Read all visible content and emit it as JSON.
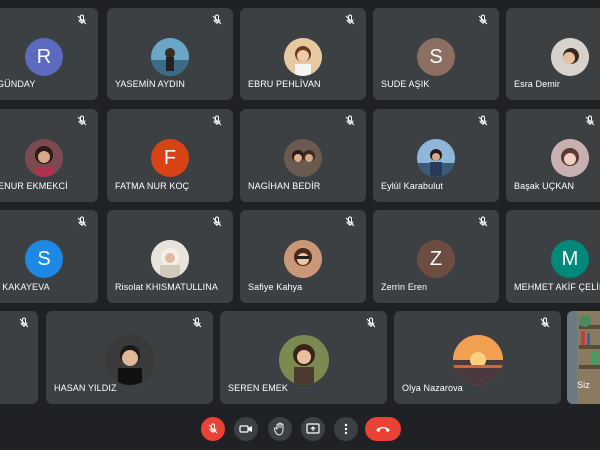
{
  "participants": [
    {
      "name": "T GÜNDAY",
      "initial": "R",
      "color": "#5c6bc0",
      "type": "letter"
    },
    {
      "name": "YASEMİN AYDIN",
      "initial": "",
      "color": "#4a6d7a",
      "type": "photo"
    },
    {
      "name": "EBRU PEHLİVAN",
      "initial": "",
      "color": "#c8a070",
      "type": "photo"
    },
    {
      "name": "SUDE AŞIK",
      "initial": "S",
      "color": "#8d6e63",
      "type": "letter"
    },
    {
      "name": "Esra Demir",
      "initial": "",
      "color": "#b0a8a0",
      "type": "photo"
    },
    {
      "name": "ENUR EKMEKCİ",
      "initial": "",
      "color": "#6d3b3b",
      "type": "photo"
    },
    {
      "name": "FATMA NUR KOÇ",
      "initial": "F",
      "color": "#d84315",
      "type": "letter"
    },
    {
      "name": "NAGİHAN BEDİR",
      "initial": "",
      "color": "#5a4a40",
      "type": "photo"
    },
    {
      "name": "Eylül Karabulut",
      "initial": "",
      "color": "#3f6f9a",
      "type": "photo"
    },
    {
      "name": "Başak UÇKAN",
      "initial": "",
      "color": "#a08080",
      "type": "photo"
    },
    {
      "name": "İ KAKAYEVA",
      "initial": "S",
      "color": "#1e88e5",
      "type": "letter"
    },
    {
      "name": "Risolat KHISMATULLINA",
      "initial": "",
      "color": "#d8d0c0",
      "type": "photo"
    },
    {
      "name": "Safiye Kahya",
      "initial": "",
      "color": "#b08060",
      "type": "photo"
    },
    {
      "name": "Zerrin Eren",
      "initial": "Z",
      "color": "#6d4c41",
      "type": "letter"
    },
    {
      "name": "MEHMET AKİF ÇELİK",
      "initial": "M",
      "color": "#00897b",
      "type": "letter"
    },
    {
      "name": "HASAN YILDIZ",
      "initial": "",
      "color": "#2a2a2a",
      "type": "photo"
    },
    {
      "name": "SEREN EMEK",
      "initial": "",
      "color": "#5a6a40",
      "type": "photo"
    },
    {
      "name": "Olya Nazarova",
      "initial": "",
      "color": "#e08040",
      "type": "photo"
    }
  ],
  "self_tile": {
    "name": "Siz"
  },
  "controls": {
    "mic": "mic-off-icon",
    "camera": "camera-icon",
    "hand": "raise-hand-icon",
    "present": "present-screen-icon",
    "more": "more-options-icon",
    "leave": "leave-call-icon"
  },
  "colors": {
    "background": "#202124",
    "tile": "#3c4043",
    "danger": "#ea4335"
  }
}
